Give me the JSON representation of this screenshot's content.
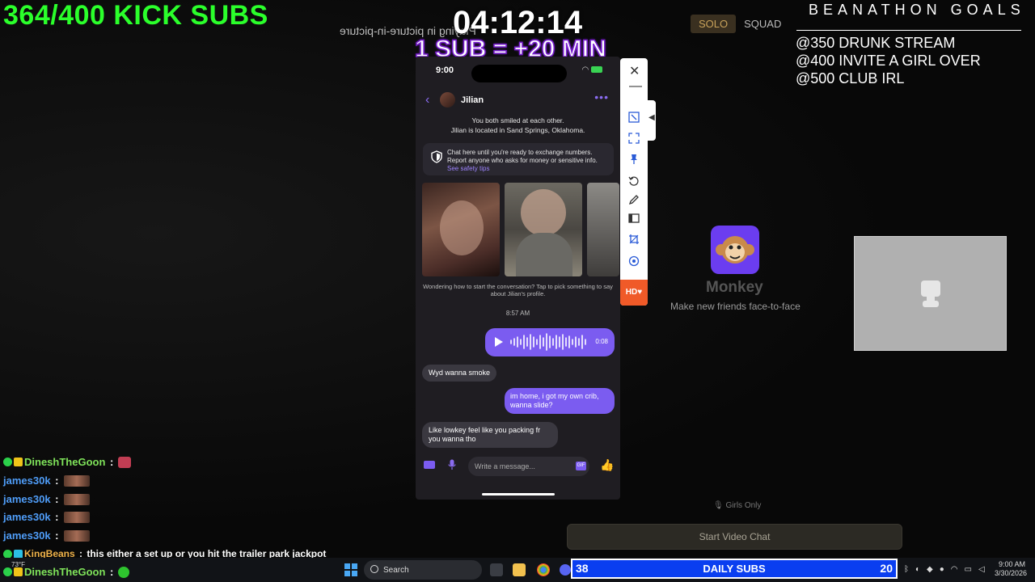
{
  "overlay": {
    "subs_count": "364/400 KICK SUBS",
    "timer": "04:12:14",
    "pip_label": "Playing in picture-in-picture",
    "sub_rate": "1 SUB = +20 MIN",
    "goals_title": "BEANATHON GOALS",
    "goals": [
      "@350 DRUNK  STREAM",
      "@400 INVITE A GIRL OVER",
      "@500 CLUB IRL"
    ]
  },
  "mode": {
    "solo": "SOLO",
    "squad": "SQUAD"
  },
  "phone": {
    "time": "9:00",
    "battery": "100",
    "contact_name": "Jilian",
    "match_line1": "You both smiled at each other.",
    "match_line2": "Jilian is located in Sand Springs, Oklahoma.",
    "safety_text": "Chat here until you're ready to exchange numbers. Report anyone who asks for money or sensitive info.",
    "safety_link": "See safety tips",
    "prompt_text": "Wondering how to start the conversation? Tap to pick something to say about Jilian's profile.",
    "msg_time": "8:57 AM",
    "voice_duration": "0:08",
    "messages": [
      {
        "dir": "in",
        "text": "Wyd wanna smoke"
      },
      {
        "dir": "out",
        "text": "im home, i got my own crib, wanna slide?"
      },
      {
        "dir": "in",
        "text": "Like lowkey feel like you packing fr you wanna tho"
      }
    ],
    "input_placeholder": "Write a message...",
    "gif_label": "GIF"
  },
  "pip": {
    "hd": "HD"
  },
  "monkey": {
    "title": "Monkey",
    "subtitle": "Make new friends face-to-face",
    "girls_only": "Girls Only",
    "start_button": "Start Video Chat"
  },
  "chat": [
    {
      "user": "DineshTheGoon",
      "color": "green",
      "badges": 2,
      "emote": "sm",
      "msg": ""
    },
    {
      "user": "james30k",
      "color": "blue",
      "badges": 0,
      "emote": "img",
      "msg": ""
    },
    {
      "user": "james30k",
      "color": "blue",
      "badges": 0,
      "emote": "img",
      "msg": ""
    },
    {
      "user": "james30k",
      "color": "blue",
      "badges": 0,
      "emote": "img",
      "msg": ""
    },
    {
      "user": "james30k",
      "color": "blue",
      "badges": 0,
      "emote": "img",
      "msg": ""
    },
    {
      "user": "KingBeans",
      "color": "gold",
      "badges": 2,
      "emote": "",
      "msg": "this either a set up or you hit the trailer park jackpot"
    },
    {
      "user": "DineshTheGoon",
      "color": "green",
      "badges": 2,
      "emote": "green",
      "msg": ""
    }
  ],
  "taskbar": {
    "search_placeholder": "Search",
    "weather": "73°F",
    "daily_left": "38",
    "daily_label": "DAILY SUBS",
    "daily_right": "20",
    "time": "9:00 AM",
    "date": "3/30/2026"
  },
  "colors": {
    "subs_green": "#2bff2b",
    "accent_purple": "#7b5cf0",
    "daily_blue": "#0a3ef0",
    "monkey_purple": "#6b3df0"
  }
}
